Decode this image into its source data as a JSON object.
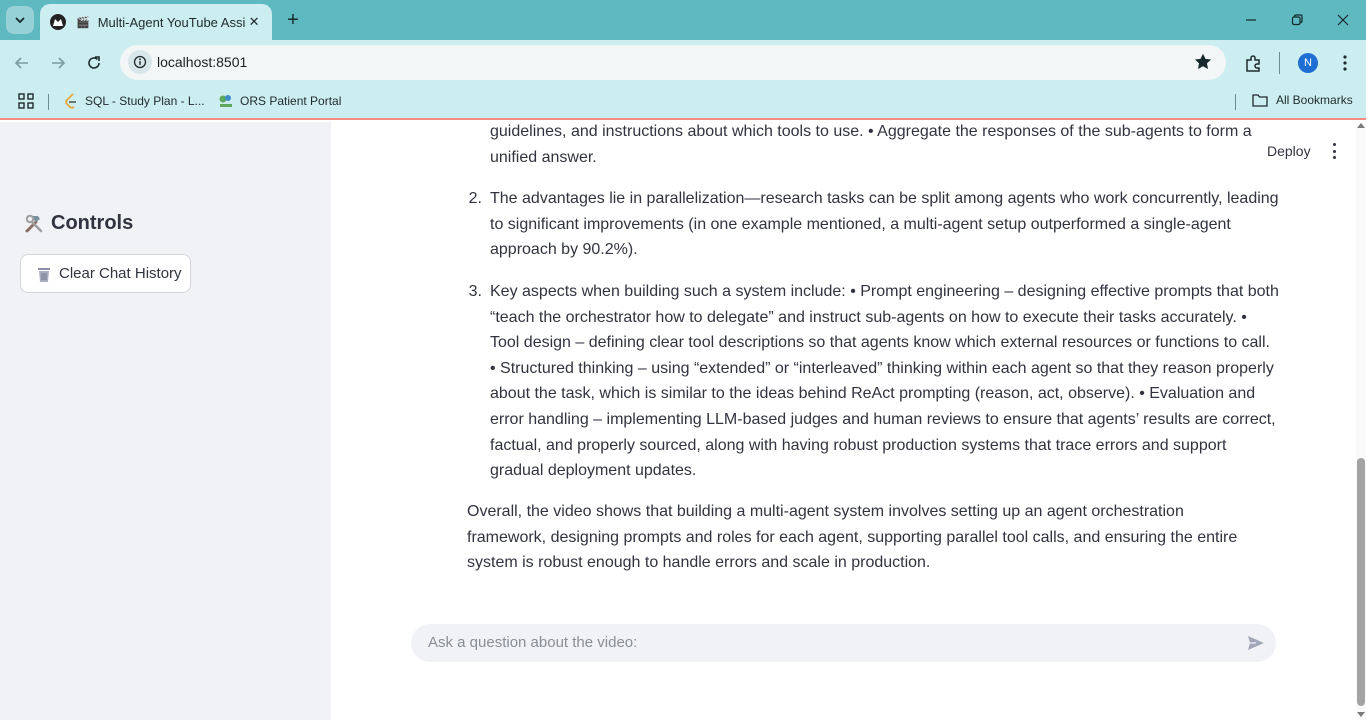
{
  "browser": {
    "tab_title": "Multi-Agent YouTube Assist",
    "url": "localhost:8501",
    "profile_initial": "N",
    "bookmarks": [
      {
        "label": "SQL - Study Plan - L..."
      },
      {
        "label": "ORS Patient Portal"
      }
    ],
    "all_bookmarks_label": "All Bookmarks",
    "colors": {
      "tabstrip": "#5fb9c1",
      "toolbar": "#cdeef0"
    }
  },
  "sidebar": {
    "controls_title": "Controls",
    "clear_button_label": "Clear Chat History"
  },
  "header": {
    "deploy_label": "Deploy"
  },
  "answer": {
    "item1_tail": "guidelines, and instructions about which tools to use.       • Aggregate the responses of the sub-agents to form a unified answer.",
    "items": [
      {
        "number": "2.",
        "text": "The advantages lie in parallelization—research tasks can be split among agents who work concurrently, leading to significant improvements (in one example mentioned, a multi-agent setup outperformed a single-agent approach by 90.2%)."
      },
      {
        "number": "3.",
        "text": "Key aspects when building such a system include:       • Prompt engineering – designing effective prompts that both “teach the orchestrator how to delegate” and instruct sub-agents on how to execute their tasks accurately.       • Tool design – defining clear tool descriptions so that agents know which external resources or functions to call.       • Structured thinking – using “extended” or “interleaved” thinking within each agent so that they reason properly about the task, which is similar to the ideas behind ReAct prompting (reason, act, observe).       • Evaluation and error handling – implementing LLM-based judges and human reviews to ensure that agents’ results are correct, factual, and properly sourced, along with having robust production systems that trace errors and support gradual deployment updates."
      }
    ],
    "summary": "Overall, the video shows that building a multi-agent system involves setting up an agent orchestration framework, designing prompts and roles for each agent, supporting parallel tool calls, and ensuring the entire system is robust enough to handle errors and scale in production."
  },
  "chat": {
    "placeholder": "Ask a question about the video:"
  }
}
